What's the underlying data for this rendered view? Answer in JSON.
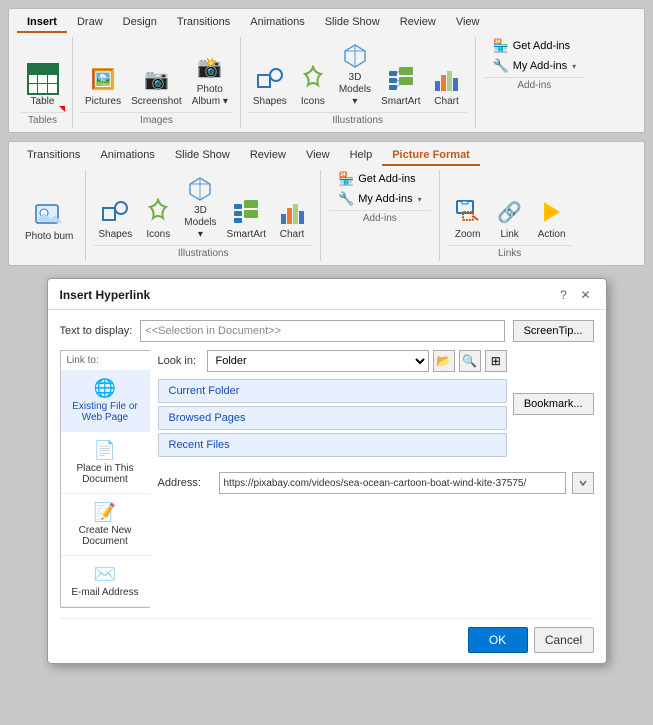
{
  "ribbon1": {
    "tabs": [
      {
        "label": "Insert",
        "active": true
      },
      {
        "label": "Draw"
      },
      {
        "label": "Design"
      },
      {
        "label": "Transitions"
      },
      {
        "label": "Animations"
      },
      {
        "label": "Slide Show"
      },
      {
        "label": "Review"
      },
      {
        "label": "View"
      }
    ],
    "groups": {
      "tables": {
        "label": "Tables",
        "items": [
          {
            "label": "Table",
            "icon": "table"
          }
        ]
      },
      "images": {
        "label": "Images",
        "items": [
          {
            "label": "Pictures",
            "icon": "🖼"
          },
          {
            "label": "Screenshot",
            "icon": "📷"
          },
          {
            "label": "Photo\nAlbum",
            "icon": "📸"
          }
        ]
      },
      "illustrations": {
        "label": "Illustrations",
        "items": [
          {
            "label": "Shapes",
            "icon": "🔷"
          },
          {
            "label": "Icons",
            "icon": "🌿"
          },
          {
            "label": "3D\nModels",
            "icon": "📦"
          },
          {
            "label": "SmartArt",
            "icon": "📊"
          },
          {
            "label": "Chart",
            "icon": "chart"
          }
        ]
      },
      "addins": {
        "label": "Add-ins",
        "items": [
          {
            "label": "Get Add-ins"
          },
          {
            "label": "My Add-ins"
          }
        ]
      }
    }
  },
  "ribbon2": {
    "tabs": [
      {
        "label": "Transitions"
      },
      {
        "label": "Animations"
      },
      {
        "label": "Slide Show"
      },
      {
        "label": "Review"
      },
      {
        "label": "View"
      },
      {
        "label": "Help"
      },
      {
        "label": "Picture Format",
        "highlight": true
      }
    ],
    "groups": {
      "images": {
        "items": [
          {
            "label": "Photo\nbum",
            "icon": "📸"
          }
        ]
      },
      "illustrations": {
        "label": "Illustrations",
        "items": [
          {
            "label": "Shapes",
            "icon": "🔷"
          },
          {
            "label": "Icons",
            "icon": "🌿"
          },
          {
            "label": "3D\nModels",
            "icon": "📦"
          },
          {
            "label": "SmartArt",
            "icon": "📊"
          },
          {
            "label": "Chart",
            "icon": "chart"
          }
        ]
      },
      "addins": {
        "label": "Add-ins",
        "items": [
          {
            "label": "Get Add-ins"
          },
          {
            "label": "My Add-ins"
          }
        ]
      },
      "links": {
        "label": "Links",
        "items": [
          {
            "label": "Zoom",
            "icon": "🔍"
          },
          {
            "label": "Link",
            "icon": "🔗"
          },
          {
            "label": "Action",
            "icon": "⚡"
          }
        ]
      }
    }
  },
  "dialog": {
    "title": "Insert Hyperlink",
    "controls": [
      "?",
      "✕"
    ],
    "link_to_label": "Link to:",
    "text_display_label": "Text to display:",
    "text_display_value": "<<Selection in Document>>",
    "screentip_btn": "ScreenTip...",
    "look_in_label": "Look in:",
    "look_in_value": "Folder",
    "bookmark_btn": "Bookmark...",
    "sidebar_items": [
      {
        "label": "Existing File or Web Page",
        "icon": "🌐",
        "active": true
      },
      {
        "label": "Place in This Document",
        "icon": "📄"
      },
      {
        "label": "Create New Document",
        "icon": "📝"
      },
      {
        "label": "E-mail Address",
        "icon": "✉"
      }
    ],
    "file_nav_items": [
      {
        "label": "Current Folder"
      },
      {
        "label": "Browsed Pages"
      },
      {
        "label": "Recent Files"
      }
    ],
    "address_label": "Address:",
    "address_value": "https://pixabay.com/videos/sea-ocean-cartoon-boat-wind-kite-37575/",
    "ok_label": "OK",
    "cancel_label": "Cancel"
  }
}
